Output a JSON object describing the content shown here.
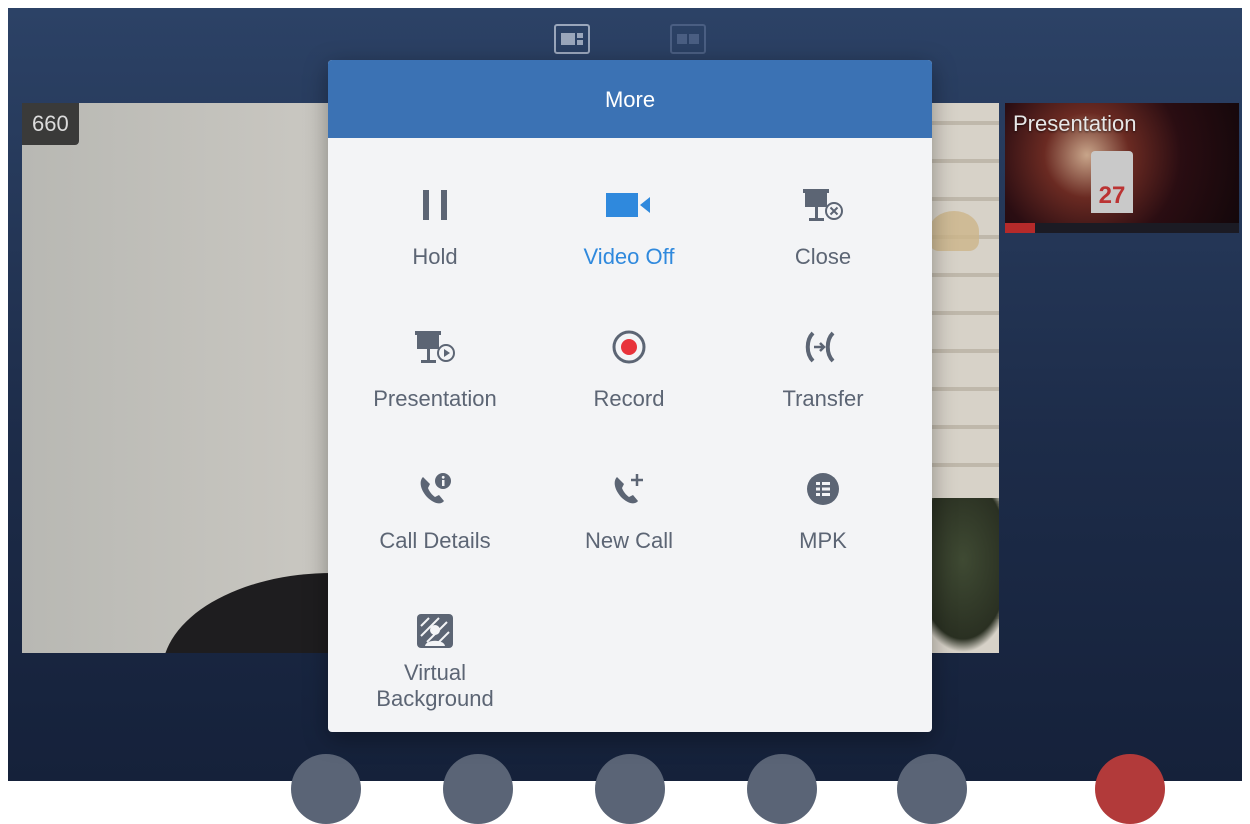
{
  "layout_controls": [
    {
      "icon": "layout-pip-icon",
      "active": true
    },
    {
      "icon": "layout-split-icon",
      "active": false
    }
  ],
  "main_video": {
    "caller_id": "660"
  },
  "presentation_thumb": {
    "label": "Presentation",
    "jersey_number": "27"
  },
  "dialog": {
    "title": "More",
    "items": [
      {
        "label": "Hold",
        "icon": "pause-icon",
        "active": false
      },
      {
        "label": "Video Off",
        "icon": "video-camera-icon",
        "active": true
      },
      {
        "label": "Close",
        "icon": "presentation-close-icon",
        "active": false
      },
      {
        "label": "Presentation",
        "icon": "presentation-play-icon",
        "active": false
      },
      {
        "label": "Record",
        "icon": "record-icon",
        "active": false
      },
      {
        "label": "Transfer",
        "icon": "transfer-icon",
        "active": false
      },
      {
        "label": "Call Details",
        "icon": "call-details-icon",
        "active": false
      },
      {
        "label": "New Call",
        "icon": "new-call-icon",
        "active": false
      },
      {
        "label": "MPK",
        "icon": "mpk-icon",
        "active": false
      },
      {
        "label": "Virtual Background",
        "label_line1": "Virtual",
        "label_line2": "Background",
        "icon": "virtual-background-icon",
        "active": false
      }
    ]
  },
  "colors": {
    "accent_blue": "#3b72b4",
    "active_text": "#2f89dd",
    "icon_gray": "#5c6574",
    "record_red": "#e8333b"
  }
}
